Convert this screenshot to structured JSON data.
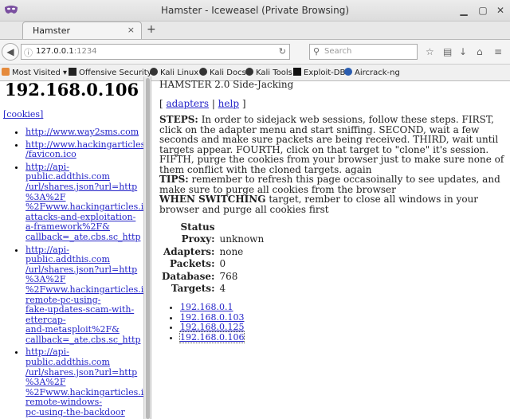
{
  "window": {
    "title": "Hamster - Iceweasel (Private Browsing)"
  },
  "tab": {
    "label": "Hamster",
    "close": "×",
    "newtab": "+"
  },
  "nav": {
    "url_host": "127.0.0.1",
    "url_port": ":1234",
    "search_placeholder": "Search"
  },
  "bookmarks": [
    {
      "label": "Most Visited ▾",
      "color": "#d55"
    },
    {
      "label": "Offensive Security",
      "color": "#222"
    },
    {
      "label": "Kali Linux",
      "color": "#222"
    },
    {
      "label": "Kali Docs",
      "color": "#222"
    },
    {
      "label": "Kali Tools",
      "color": "#222"
    },
    {
      "label": "Exploit-DB",
      "color": "#222"
    },
    {
      "label": "Aircrack-ng",
      "color": "#2a5db0"
    }
  ],
  "left": {
    "ip": "192.168.0.106",
    "cookies_link": "[cookies]",
    "urls": [
      "http://www.way2sms.com",
      "http://www.hackingarticles.in\n/favicon.ico",
      "http://api-\npublic.addthis.com\n/url/shares.json?url=http\n%3A%2F\n%2Fwww.hackingarticles.in\nattacks-and-exploitation-\na-framework%2F&\ncallback=_ate.cbs.sc_http",
      "http://api-\npublic.addthis.com\n/url/shares.json?url=http\n%3A%2F\n%2Fwww.hackingarticles.in\nremote-pc-using-\nfake-updates-scam-with-\nettercap-\nand-metasploit%2F&\ncallback=_ate.cbs.sc_http",
      "http://api-\npublic.addthis.com\n/url/shares.json?url=http\n%3A%2F\n%2Fwww.hackingarticles.in\nremote-windows-\npc-using-the-backdoor"
    ]
  },
  "right": {
    "title": "HAMSTER 2.0 Side-Jacking",
    "menu_open": "[ ",
    "adapters": "adapters",
    "sep": " | ",
    "help": "help",
    "menu_close": " ]",
    "steps_label": "STEPS:",
    "steps_text": " In order to sidejack web sessions, follow these steps. FIRST, click on the adapter menu and start sniffing. SECOND, wait a few seconds and make sure packets are being received. THIRD, wait until targets appear. FOURTH, click on that target to \"clone\" it's session. FIFTH, purge the cookies from your browser just to make sure none of them conflict with the cloned targets. again",
    "tips_label": "TIPS:",
    "tips_text": " remember to refresh this page occasoinally to see updates, and make sure to purge all cookies from the browser",
    "switch_label": "WHEN SWITCHING",
    "switch_text": " target, rember to close all windows in your browser and purge all cookies first",
    "status_head": "Status",
    "status": [
      {
        "key": "Proxy:",
        "value": "unknown"
      },
      {
        "key": "Adapters:",
        "value": "none"
      },
      {
        "key": "Packets:",
        "value": "0"
      },
      {
        "key": "Database:",
        "value": "768"
      },
      {
        "key": "Targets:",
        "value": "4"
      }
    ],
    "targets": [
      "192.168.0.1",
      "192.168.0.103",
      "192.168.0.125",
      "192.168.0.106"
    ]
  }
}
